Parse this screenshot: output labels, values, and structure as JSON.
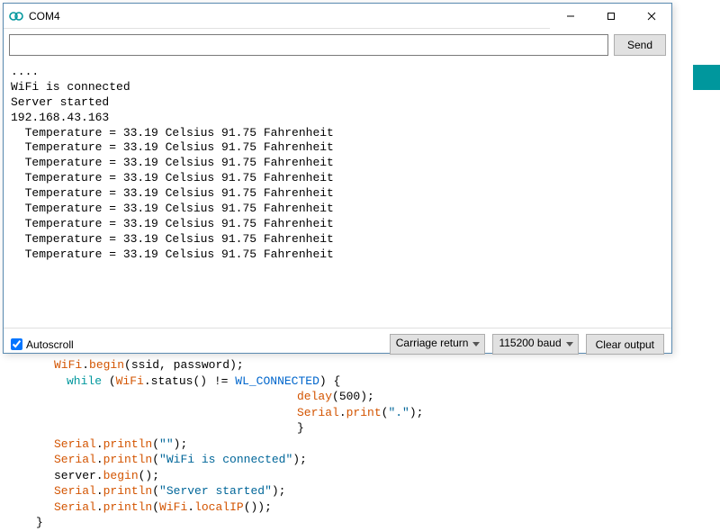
{
  "window": {
    "title": "COM4"
  },
  "toolbar": {
    "send_label": "Send",
    "input_value": ""
  },
  "output": {
    "lines": [
      "....",
      "WiFi is connected",
      "Server started",
      "192.168.43.163",
      "  Temperature = 33.19 Celsius 91.75 Fahrenheit",
      "  Temperature = 33.19 Celsius 91.75 Fahrenheit",
      "  Temperature = 33.19 Celsius 91.75 Fahrenheit",
      "  Temperature = 33.19 Celsius 91.75 Fahrenheit",
      "  Temperature = 33.19 Celsius 91.75 Fahrenheit",
      "  Temperature = 33.19 Celsius 91.75 Fahrenheit",
      "  Temperature = 33.19 Celsius 91.75 Fahrenheit",
      "  Temperature = 33.19 Celsius 91.75 Fahrenheit",
      "  Temperature = 33.19 Celsius 91.75 Fahrenheit"
    ]
  },
  "footer": {
    "autoscroll_label": "Autoscroll",
    "line_ending": "Carriage return",
    "baud": "115200 baud",
    "clear_label": "Clear output"
  },
  "code": {
    "l0a": "WiFi",
    "l0b": ".",
    "l0c": "begin",
    "l0d": "(ssid, password);",
    "l1a": "while",
    "l1b": " (",
    "l1c": "WiFi",
    "l1d": ".status() != ",
    "l1e": "WL_CONNECTED",
    "l1f": ") {",
    "l2a": "delay",
    "l2b": "(500);",
    "l3a": "Serial",
    "l3b": ".",
    "l3c": "print",
    "l3d": "(",
    "l3e": "\".\"",
    "l3f": ");",
    "l4": "}",
    "l5a": "Serial",
    "l5b": ".",
    "l5c": "println",
    "l5d": "(",
    "l5e": "\"\"",
    "l5f": ");",
    "l6a": "Serial",
    "l6b": ".",
    "l6c": "println",
    "l6d": "(",
    "l6e": "\"WiFi is connected\"",
    "l6f": ");",
    "l7a": "server.",
    "l7b": "begin",
    "l7c": "();",
    "l8a": "Serial",
    "l8b": ".",
    "l8c": "println",
    "l8d": "(",
    "l8e": "\"Server started\"",
    "l8f": ");",
    "l9a": "Serial",
    "l9b": ".",
    "l9c": "println",
    "l9d": "(",
    "l9e": "WiFi",
    "l9f": ".",
    "l9g": "localIP",
    "l9h": "());",
    "l10": "}"
  }
}
